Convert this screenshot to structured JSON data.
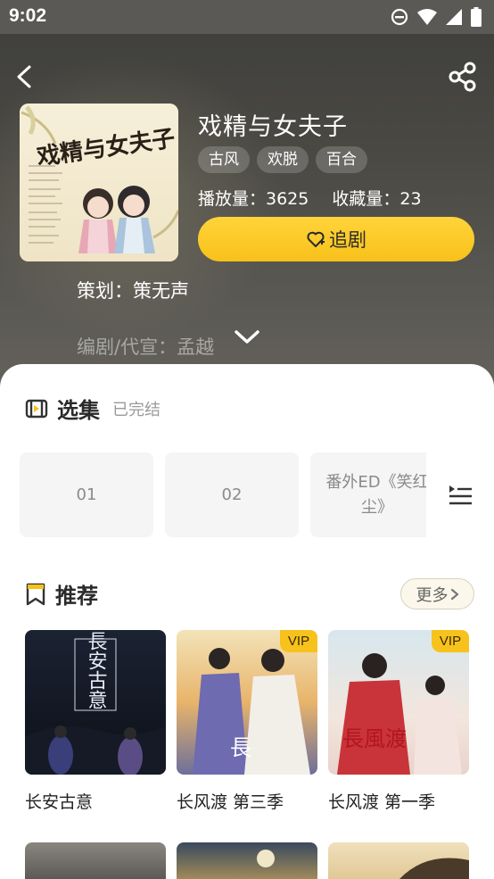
{
  "status_bar": {
    "time": "9:02",
    "icons": [
      "dnd-icon",
      "wifi-icon",
      "signal-icon",
      "battery-icon"
    ]
  },
  "header": {
    "back_icon": "back-arrow-icon",
    "share_icon": "share-icon"
  },
  "drama": {
    "title": "戏精与女夫子",
    "tags": [
      "古风",
      "欢脱",
      "百合"
    ],
    "play_count": "播放量：3625",
    "collect_count": "收藏量：23",
    "follow_label": "追剧",
    "planner": "策划：策无声",
    "writer": "编剧/代宣：孟越",
    "cover_text": "戏精与女夫子"
  },
  "episodes": {
    "title": "选集",
    "status": "已完结",
    "items": [
      "01",
      "02",
      "番外ED《笑红尘》"
    ]
  },
  "recommend": {
    "title": "推荐",
    "more_label": "更多",
    "items": [
      {
        "name": "长安古意",
        "vip": false,
        "poster_text": "長安古意"
      },
      {
        "name": "长风渡 第三季",
        "vip": true,
        "vip_label": "VIP"
      },
      {
        "name": "长风渡  第一季",
        "vip": true,
        "vip_label": "VIP"
      }
    ]
  },
  "colors": {
    "accent": "#f8c11a",
    "hero_bg": "#4a4944",
    "sheet_bg": "#ffffff"
  }
}
